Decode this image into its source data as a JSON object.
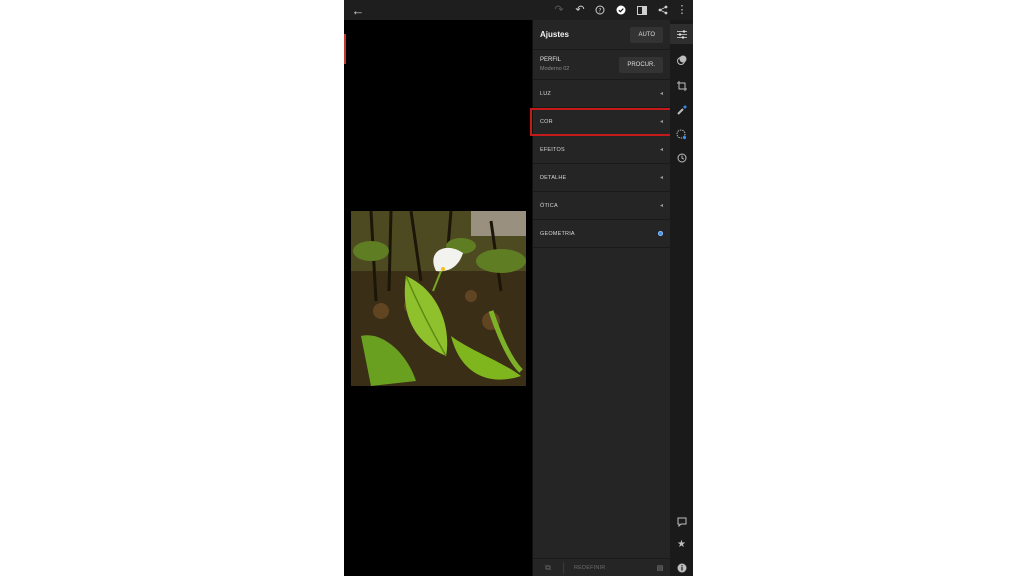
{
  "panel": {
    "title": "Ajustes",
    "auto_label": "AUTO",
    "profile_label": "PERFIL",
    "profile_value": "Moderno 02",
    "browse_label": "PROCUR."
  },
  "sections": [
    {
      "label": "LUZ"
    },
    {
      "label": "COR"
    },
    {
      "label": "EFEITOS"
    },
    {
      "label": "DETALHE"
    },
    {
      "label": "ÓTICA"
    },
    {
      "label": "GEOMETRIA"
    }
  ],
  "footer": {
    "reset_label": "REDEFINIR"
  },
  "colors": {
    "accent": "#3b8ded",
    "highlight": "#c41a1a",
    "panel": "#252525"
  },
  "icons": {
    "toolbar": [
      "back-arrow-icon",
      "redo-icon",
      "undo-icon",
      "help-icon",
      "check-icon",
      "compare-icon",
      "share-icon",
      "more-icon"
    ],
    "rail": [
      "sliders-icon",
      "presets-icon",
      "crop-icon",
      "healing-icon",
      "masking-icon",
      "history-icon",
      "comment-icon",
      "star-icon",
      "info-icon"
    ]
  }
}
